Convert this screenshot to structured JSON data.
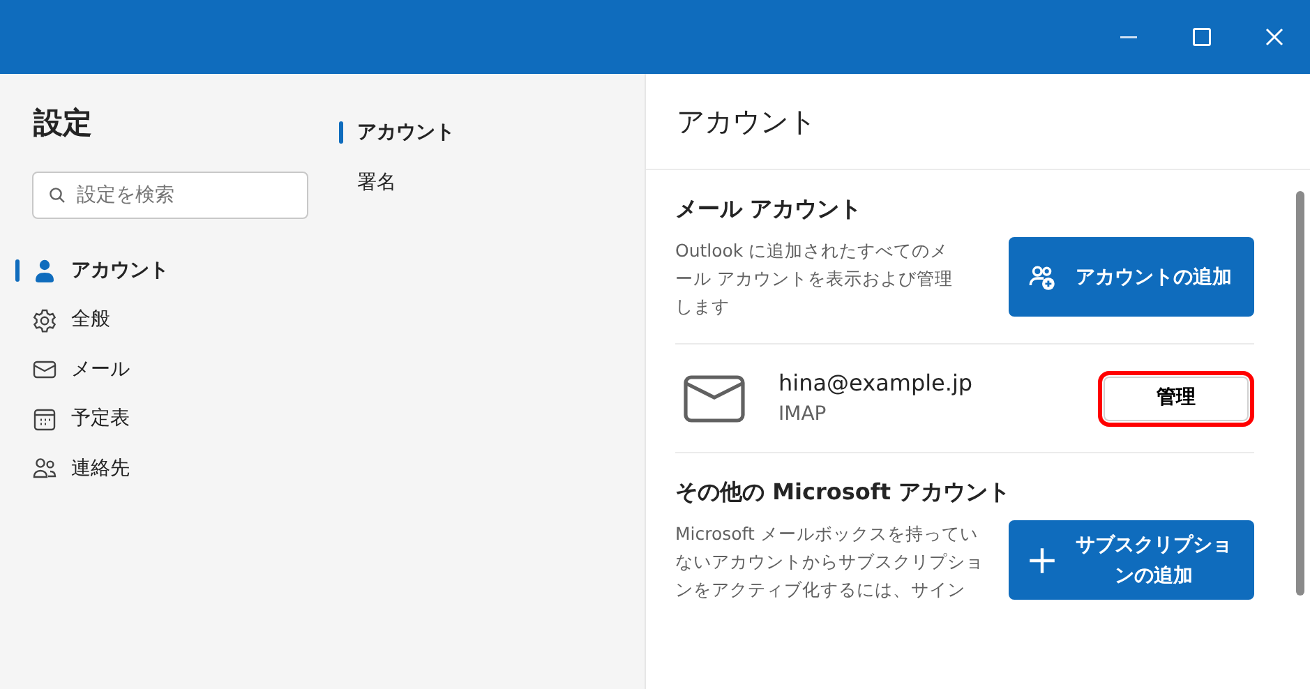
{
  "sidebar": {
    "title": "設定",
    "search": {
      "placeholder": "設定を検索"
    },
    "items": [
      {
        "label": "アカウント",
        "selected": true
      },
      {
        "label": "全般",
        "selected": false
      },
      {
        "label": "メール",
        "selected": false
      },
      {
        "label": "予定表",
        "selected": false
      },
      {
        "label": "連絡先",
        "selected": false
      }
    ]
  },
  "subnav": {
    "items": [
      {
        "label": "アカウント",
        "selected": true
      },
      {
        "label": "署名",
        "selected": false
      }
    ]
  },
  "pane": {
    "title": "アカウント",
    "mail_accounts": {
      "heading": "メール アカウント",
      "description": "Outlook に追加されたすべてのメール アカウントを表示および管理します",
      "button": {
        "label": "アカウントの追加"
      }
    },
    "account": {
      "email": "hina@example.jp",
      "type": "IMAP",
      "button": {
        "label": "管理",
        "highlighted": true
      }
    },
    "other_accounts": {
      "heading": "その他の Microsoft アカウント",
      "description": "Microsoft メールボックスを持っていないアカウントからサブスクリプションをアクティブ化するには、サイン",
      "button": {
        "label": "サブスクリプションの追加"
      }
    }
  }
}
